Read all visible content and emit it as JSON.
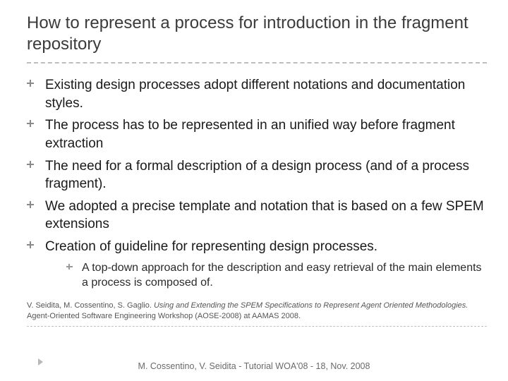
{
  "title": "How to represent a process for introduction in the fragment repository",
  "bullets": [
    {
      "text": "Existing design processes adopt different notations and documentation styles."
    },
    {
      "text": "The process has to be represented in an unified way before fragment extraction"
    },
    {
      "text": "The need for a formal description of a design process (and of a process fragment)."
    },
    {
      "text": "We adopted a precise template and notation that is based on a few SPEM extensions"
    },
    {
      "text": "Creation of guideline for representing design processes.",
      "sub": [
        {
          "text": "A top-down approach for the description and easy retrieval of the main elements a process is composed of."
        }
      ]
    }
  ],
  "citation": {
    "authors": "V. Seidita, M. Cossentino, S. Gaglio. ",
    "title_italic": "Using and Extending the SPEM Specifications to Represent Agent Oriented Methodologies.",
    "venue": " Agent-Oriented Software Engineering Workshop (AOSE-2008) at AAMAS 2008."
  },
  "footer": "M. Cossentino, V. Seidita - Tutorial WOA'08 - 18, Nov. 2008"
}
